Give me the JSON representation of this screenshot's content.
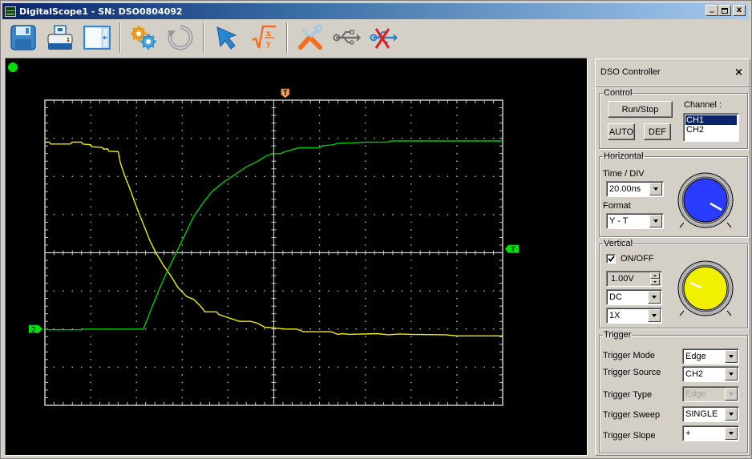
{
  "window": {
    "title": "DigitalScope1 - SN: DSO0804092",
    "controls": {
      "minimize": "_",
      "maximize": "□",
      "close": "x"
    }
  },
  "toolbar": {
    "buttons": [
      {
        "name": "save",
        "icon": "floppy-disk-icon"
      },
      {
        "name": "print",
        "icon": "printer-icon"
      },
      {
        "name": "panel-toggle",
        "icon": "panel-layout-icon"
      },
      {
        "name": "settings",
        "icon": "gears-icon"
      },
      {
        "name": "refresh",
        "icon": "refresh-icon"
      },
      {
        "name": "pointer",
        "icon": "cursor-arrow-icon"
      },
      {
        "name": "math",
        "icon": "sqrt-x-over-y-icon"
      },
      {
        "name": "tools",
        "icon": "screwdriver-wrench-icon"
      },
      {
        "name": "usb-connect",
        "icon": "usb-icon"
      },
      {
        "name": "usb-disconnect",
        "icon": "usb-disconnected-icon"
      }
    ]
  },
  "scope": {
    "status_color": "#00e000",
    "grid": {
      "h_divisions": 10,
      "v_divisions": 8,
      "subdivisions": 5
    },
    "markers": {
      "trigger_position": {
        "label": "T",
        "color": "#f4a460",
        "division": 5.25
      },
      "trigger_level": {
        "label": "T",
        "color": "#00e000",
        "division": 4.1
      },
      "ch2_ground": {
        "label": "2",
        "color": "#00e000",
        "division": 2.0
      }
    },
    "traces": [
      {
        "name": "CH1",
        "color": "#f0f000",
        "points_div": [
          [
            0,
            6.9
          ],
          [
            0.2,
            6.9
          ],
          [
            0.25,
            6.85
          ],
          [
            1.1,
            6.85
          ],
          [
            1.2,
            6.9
          ],
          [
            1.6,
            6.9
          ],
          [
            1.65,
            6.85
          ],
          [
            2.0,
            6.83
          ],
          [
            2.05,
            6.78
          ],
          [
            2.5,
            6.76
          ],
          [
            2.55,
            6.72
          ],
          [
            2.75,
            6.72
          ],
          [
            2.8,
            6.66
          ],
          [
            3.2,
            6.65
          ],
          [
            3.3,
            6.35
          ],
          [
            3.5,
            6.0
          ],
          [
            3.7,
            5.7
          ],
          [
            4.0,
            5.2
          ],
          [
            4.3,
            4.75
          ],
          [
            4.6,
            4.3
          ],
          [
            4.9,
            3.95
          ],
          [
            5.2,
            3.65
          ],
          [
            5.5,
            3.4
          ],
          [
            5.8,
            3.1
          ],
          [
            6.2,
            2.85
          ],
          [
            6.5,
            2.78
          ],
          [
            6.8,
            2.6
          ],
          [
            7.0,
            2.45
          ],
          [
            7.5,
            2.45
          ],
          [
            7.6,
            2.38
          ],
          [
            8.0,
            2.3
          ],
          [
            8.5,
            2.2
          ],
          [
            9.0,
            2.2
          ],
          [
            9.3,
            2.15
          ],
          [
            9.6,
            2.05
          ],
          [
            10.0,
            2.03
          ],
          [
            10.5,
            2.0
          ],
          [
            11.0,
            2.0
          ],
          [
            11.3,
            1.93
          ],
          [
            12.5,
            1.93
          ],
          [
            12.8,
            1.86
          ],
          [
            13.0,
            1.88
          ],
          [
            13.3,
            1.86
          ],
          [
            14.5,
            1.88
          ],
          [
            15.0,
            1.85
          ],
          [
            15.5,
            1.87
          ],
          [
            16.0,
            1.86
          ],
          [
            17.5,
            1.85
          ],
          [
            18.0,
            1.82
          ],
          [
            20,
            1.82
          ]
        ]
      },
      {
        "name": "CH2",
        "color": "#00c800",
        "points_div": [
          [
            0,
            2.0
          ],
          [
            0.2,
            1.98
          ],
          [
            1.6,
            1.98
          ],
          [
            1.65,
            2.0
          ],
          [
            4.3,
            2.0
          ],
          [
            4.6,
            2.45
          ],
          [
            5.0,
            3.05
          ],
          [
            5.3,
            3.45
          ],
          [
            5.7,
            3.95
          ],
          [
            6.1,
            4.45
          ],
          [
            6.5,
            4.95
          ],
          [
            6.9,
            5.3
          ],
          [
            7.3,
            5.6
          ],
          [
            7.8,
            5.85
          ],
          [
            8.3,
            6.05
          ],
          [
            8.8,
            6.25
          ],
          [
            9.3,
            6.4
          ],
          [
            9.7,
            6.55
          ],
          [
            10.0,
            6.6
          ],
          [
            10.3,
            6.6
          ],
          [
            10.5,
            6.65
          ],
          [
            10.8,
            6.7
          ],
          [
            11.1,
            6.75
          ],
          [
            12.0,
            6.75
          ],
          [
            12.1,
            6.8
          ],
          [
            12.6,
            6.83
          ],
          [
            12.8,
            6.87
          ],
          [
            13.5,
            6.88
          ],
          [
            14.0,
            6.9
          ],
          [
            15.0,
            6.9
          ],
          [
            15.1,
            6.93
          ],
          [
            20,
            6.93
          ]
        ]
      }
    ]
  },
  "controller": {
    "title": "DSO Controller",
    "close_label": "×",
    "control": {
      "legend": "Control",
      "run_stop": "Run/Stop",
      "auto": "AUTO",
      "def": "DEF",
      "channel_label": "Channel :",
      "channels": [
        "CH1",
        "CH2"
      ],
      "selected_channel": "CH1"
    },
    "horizontal": {
      "legend": "Horizontal",
      "time_div_label": "Time / DIV",
      "time_div_value": "20.00ns",
      "format_label": "Format",
      "format_value": "Y - T",
      "knob_color": "#2a3cff"
    },
    "vertical": {
      "legend": "Vertical",
      "onoff_label": "ON/OFF",
      "onoff_checked": true,
      "volts_div_value": "1.00V",
      "coupling_value": "DC",
      "probe_value": "1X",
      "knob_color": "#f0f000"
    },
    "trigger": {
      "legend": "Trigger",
      "rows": [
        {
          "label": "Trigger Mode",
          "value": "Edge",
          "disabled": false
        },
        {
          "label": "Trigger Source",
          "value": "CH2",
          "disabled": false
        },
        {
          "label": "Trigger Type",
          "value": "Edge",
          "disabled": true
        },
        {
          "label": "Trigger Sweep",
          "value": "SINGLE",
          "disabled": false
        },
        {
          "label": "Trigger Slope",
          "value": "+",
          "disabled": false
        }
      ]
    }
  }
}
